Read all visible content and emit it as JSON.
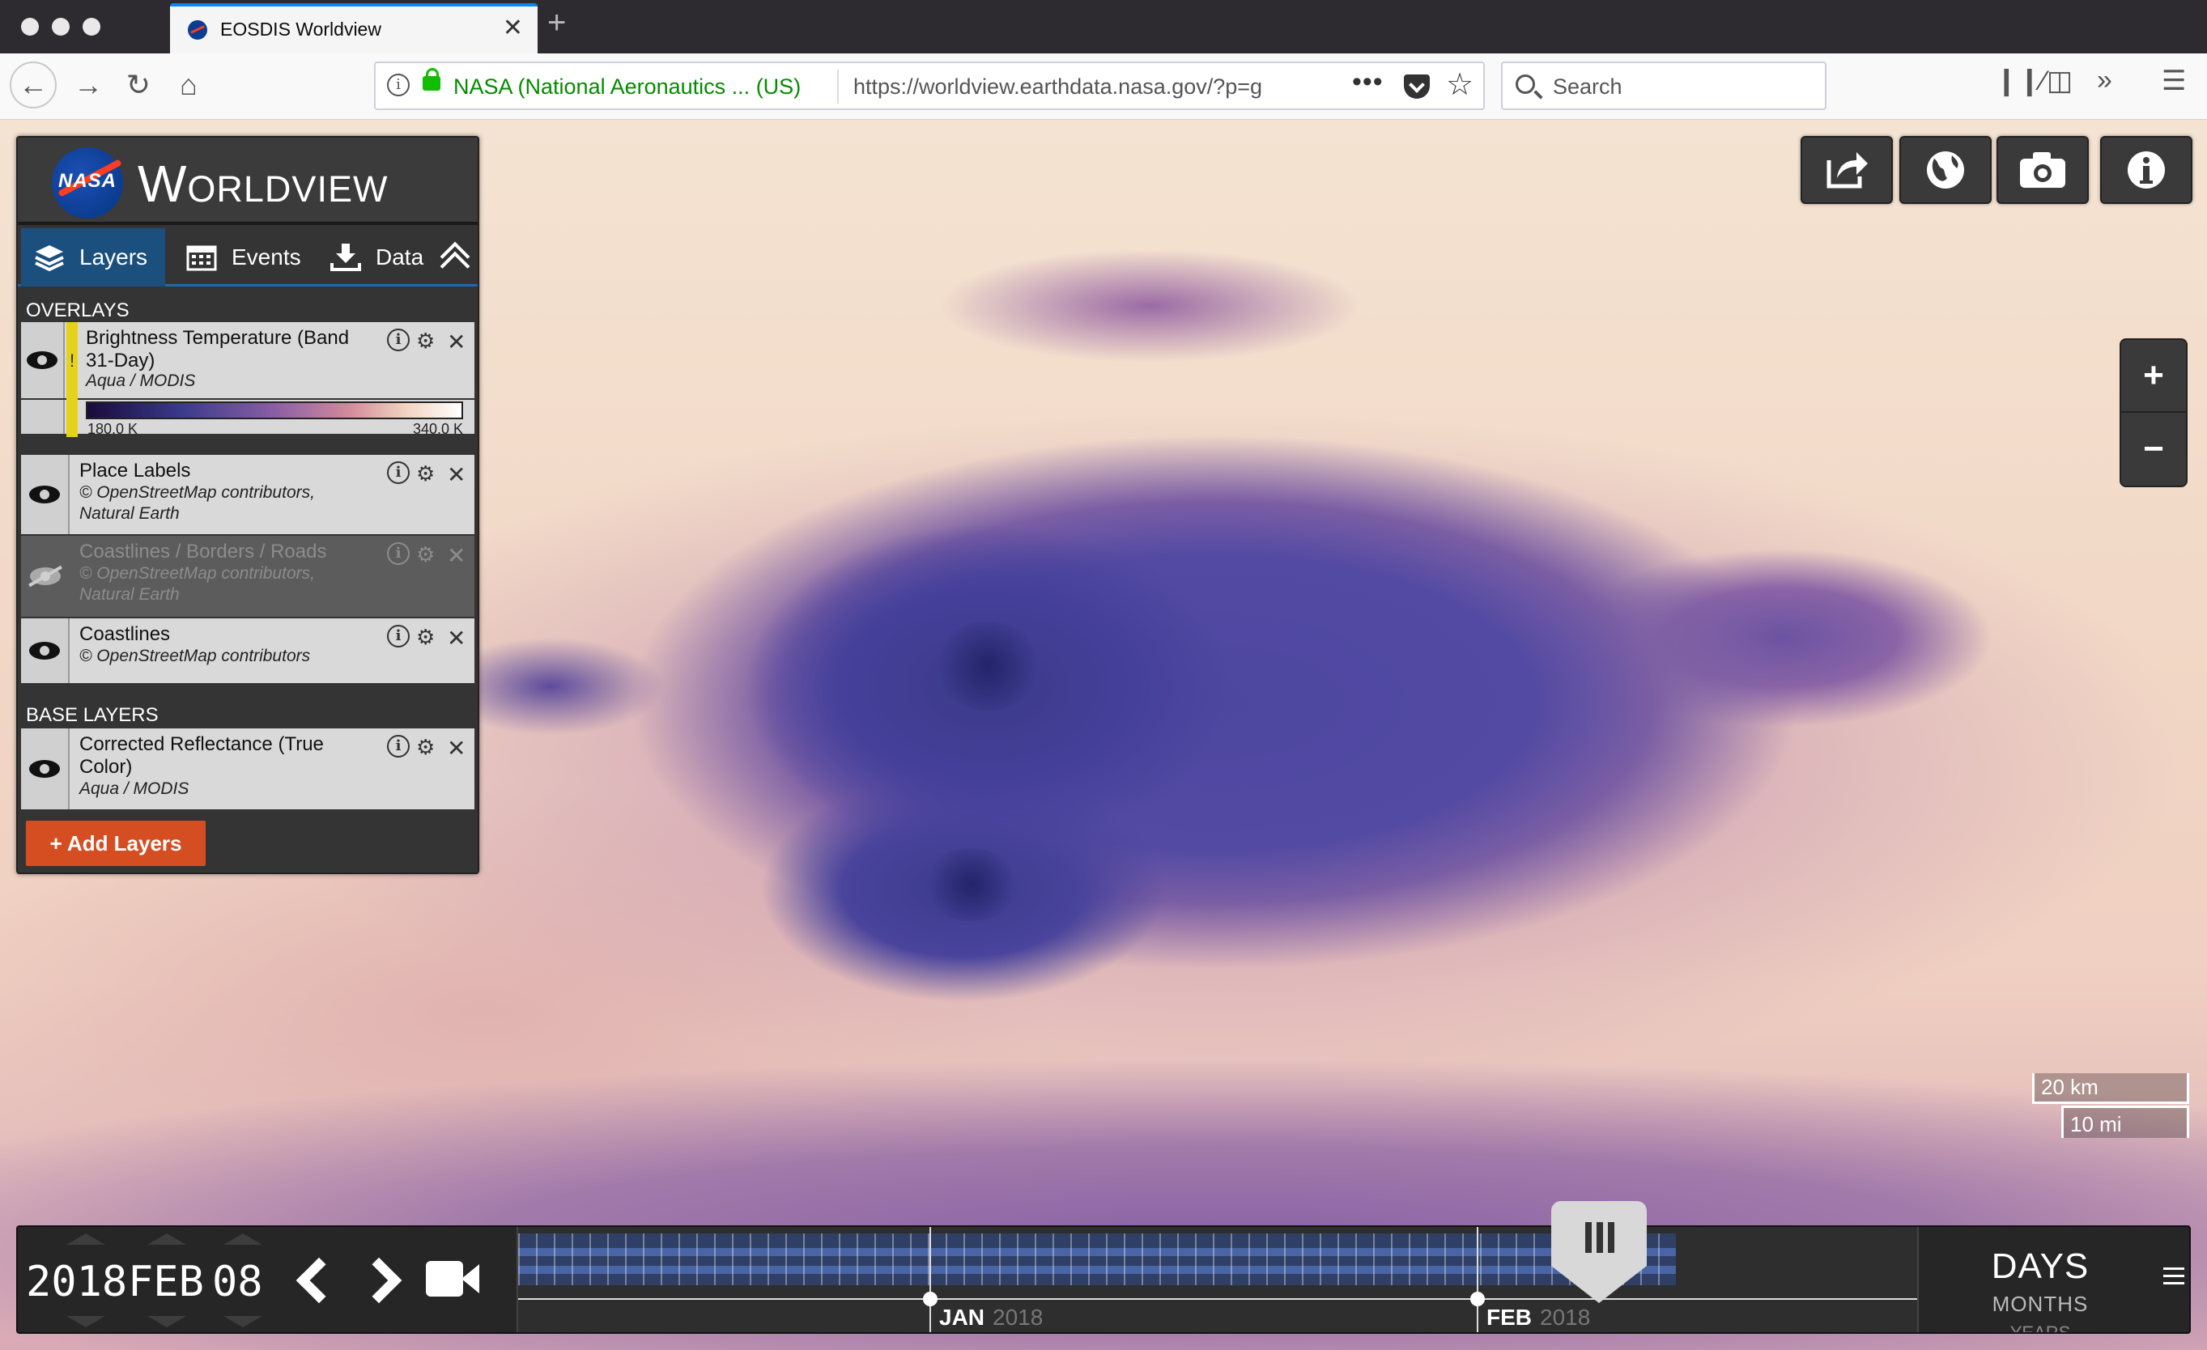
{
  "browser": {
    "tab_title": "EOSDIS Worldview",
    "new_tab": "+",
    "tab_close": "✕",
    "url_owner": "NASA (National Aeronautics ...  (US)",
    "url": "https://worldview.earthdata.nasa.gov/?p=g",
    "url_more": "•••",
    "search_placeholder": "Search"
  },
  "app": {
    "logo_text": "NASA",
    "title": "Worldview"
  },
  "sidebar": {
    "tabs": [
      {
        "label": "Layers",
        "icon": "layers-icon",
        "active": true
      },
      {
        "label": "Events",
        "icon": "calendar-icon",
        "active": false
      },
      {
        "label": "Data",
        "icon": "download-icon",
        "active": false
      }
    ],
    "overlays_heading": "OVERLAYS",
    "base_heading": "BASE LAYERS",
    "overlays": [
      {
        "name": "Brightness Temperature (Band 31-Day)",
        "source": "Aqua / MODIS",
        "visible": true,
        "warning": "!",
        "legend_min": "180.0 K",
        "legend_max": "340.0 K"
      },
      {
        "name": "Place Labels",
        "source": "© OpenStreetMap contributors, Natural Earth",
        "visible": true
      },
      {
        "name": "Coastlines / Borders / Roads",
        "source": "© OpenStreetMap contributors, Natural Earth",
        "visible": false
      },
      {
        "name": "Coastlines",
        "source": "© OpenStreetMap contributors",
        "visible": true
      }
    ],
    "base_layers": [
      {
        "name": "Corrected Reflectance (True Color)",
        "source": "Aqua / MODIS",
        "visible": true
      }
    ],
    "add_layers_label": "+ Add Layers"
  },
  "tools": [
    {
      "name": "share",
      "icon": "share-icon"
    },
    {
      "name": "projection",
      "icon": "globe-icon"
    },
    {
      "name": "snapshot",
      "icon": "camera-icon"
    },
    {
      "name": "info",
      "icon": "info-icon"
    }
  ],
  "zoom": {
    "in": "+",
    "out": "−"
  },
  "scale": {
    "km": "20 km",
    "mi": "10 mi"
  },
  "timeline": {
    "year": "2018",
    "month": "FEB",
    "day": "08",
    "months": [
      {
        "label": "JAN",
        "year": "2018"
      },
      {
        "label": "FEB",
        "year": "2018"
      }
    ],
    "zoom_days": "DAYS",
    "zoom_months": "MONTHS",
    "zoom_years": "YEARS"
  },
  "colors": {
    "accent_orange": "#d54e21",
    "active_tab": "#1b4f7e",
    "warning_yellow": "#e6d21a",
    "legend_gradient": [
      "#1a0b3a",
      "#3a3a8c",
      "#8a5ea6",
      "#d48a9a",
      "#f3d3c0",
      "#ffffff"
    ]
  }
}
